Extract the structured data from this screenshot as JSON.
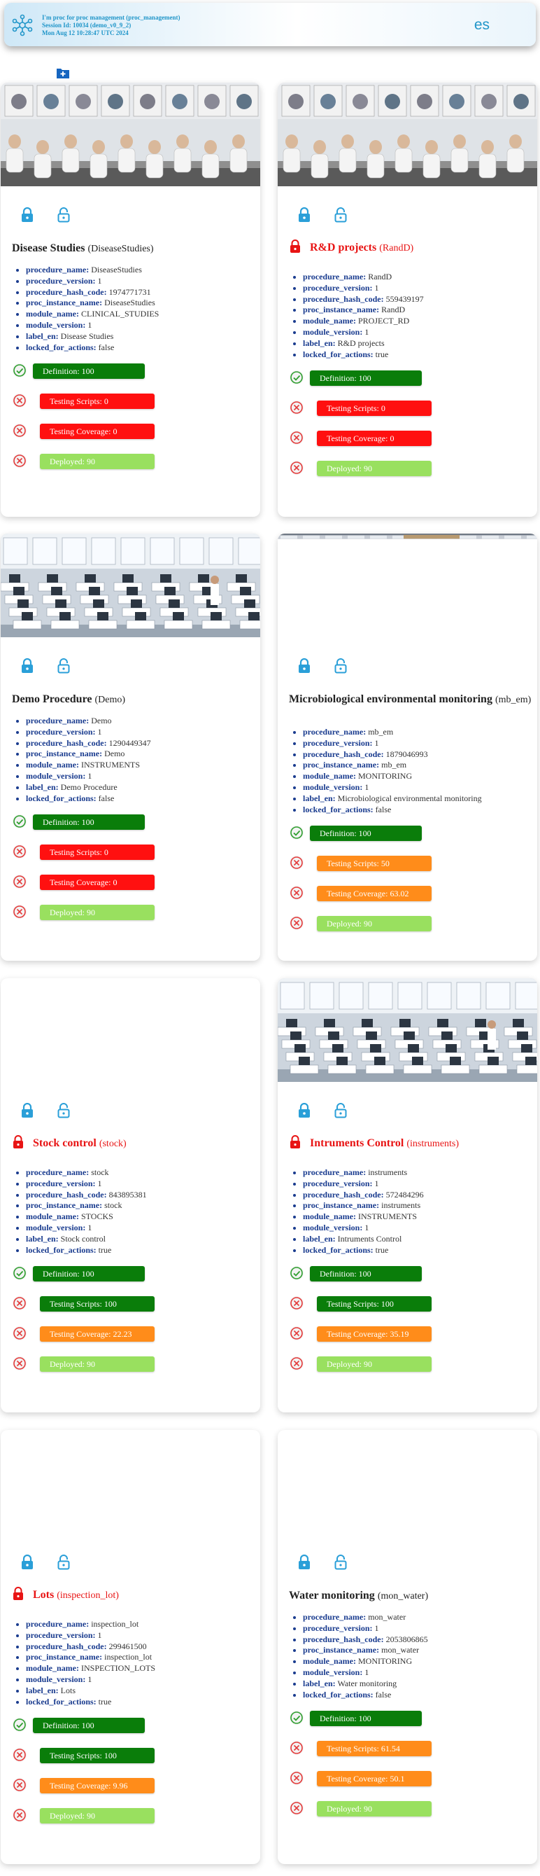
{
  "header": {
    "line1": "I'm proc for proc management (proc_management)",
    "line2": "Session Id: 10034 (demo_v0_9_2)",
    "line3": "Mon Aug 12 10:28:47 UTC 2024",
    "lang": "es"
  },
  "colors": {
    "green": "#0a7d0a",
    "red": "#ff1010",
    "orange": "#ff8c1a",
    "lightgreen": "#99e05f",
    "accent": "#2196c9"
  },
  "cards": [
    {
      "title": "Disease Studies",
      "id": "(DiseaseStudies)",
      "locked": false,
      "props": {
        "procedure_name": "DiseaseStudies",
        "procedure_version": "1",
        "procedure_hash_code": "1974771731",
        "proc_instance_name": "DiseaseStudies",
        "module_name": "CLINICAL_STUDIES",
        "module_version": "1",
        "label_en": "Disease Studies",
        "locked_for_actions": "false"
      },
      "status": {
        "definition": "Definition: 100",
        "scripts": "Testing Scripts: 0",
        "coverage": "Testing Coverage: 0",
        "deployed": "Deployed: 90"
      }
    },
    {
      "title": "R&D projects",
      "id": "(RandD)",
      "locked": true,
      "props": {
        "procedure_name": "RandD",
        "procedure_version": "1",
        "procedure_hash_code": "559439197",
        "proc_instance_name": "RandD",
        "module_name": "PROJECT_RD",
        "module_version": "1",
        "label_en": "R&D projects",
        "locked_for_actions": "true"
      },
      "status": {
        "definition": "Definition: 100",
        "scripts": "Testing Scripts: 0",
        "coverage": "Testing Coverage: 0",
        "deployed": "Deployed: 90"
      }
    },
    {
      "title": "Demo Procedure",
      "id": "(Demo)",
      "locked": false,
      "props": {
        "procedure_name": "Demo",
        "procedure_version": "1",
        "procedure_hash_code": "1290449347",
        "proc_instance_name": "Demo",
        "module_name": "INSTRUMENTS",
        "module_version": "1",
        "label_en": "Demo Procedure",
        "locked_for_actions": "false"
      },
      "status": {
        "definition": "Definition: 100",
        "scripts": "Testing Scripts: 0",
        "coverage": "Testing Coverage: 0",
        "deployed": "Deployed: 90"
      }
    },
    {
      "title": "Microbiological environmental monitoring",
      "id": "(mb_em)",
      "locked": false,
      "props": {
        "procedure_name": "mb_em",
        "procedure_version": "1",
        "procedure_hash_code": "1879046993",
        "proc_instance_name": "mb_em",
        "module_name": "MONITORING",
        "module_version": "1",
        "label_en": "Microbiological environmental monitoring",
        "locked_for_actions": "false"
      },
      "status": {
        "definition": "Definition: 100",
        "scripts": "Testing Scripts: 50",
        "coverage": "Testing Coverage: 63.02",
        "deployed": "Deployed: 90"
      }
    },
    {
      "title": "Stock control",
      "id": "(stock)",
      "locked": true,
      "props": {
        "procedure_name": "stock",
        "procedure_version": "1",
        "procedure_hash_code": "843895381",
        "proc_instance_name": "stock",
        "module_name": "STOCKS",
        "module_version": "1",
        "label_en": "Stock control",
        "locked_for_actions": "true"
      },
      "status": {
        "definition": "Definition: 100",
        "scripts": "Testing Scripts: 100",
        "coverage": "Testing Coverage: 22.23",
        "deployed": "Deployed: 90"
      }
    },
    {
      "title": "Intruments Control",
      "id": "(instruments)",
      "locked": true,
      "props": {
        "procedure_name": "instruments",
        "procedure_version": "1",
        "procedure_hash_code": "572484296",
        "proc_instance_name": "instruments",
        "module_name": "INSTRUMENTS",
        "module_version": "1",
        "label_en": "Intruments Control",
        "locked_for_actions": "true"
      },
      "status": {
        "definition": "Definition: 100",
        "scripts": "Testing Scripts: 100",
        "coverage": "Testing Coverage: 35.19",
        "deployed": "Deployed: 90"
      }
    },
    {
      "title": "Lots",
      "id": "(inspection_lot)",
      "locked": true,
      "props": {
        "procedure_name": "inspection_lot",
        "procedure_version": "1",
        "procedure_hash_code": "299461500",
        "proc_instance_name": "inspection_lot",
        "module_name": "INSPECTION_LOTS",
        "module_version": "1",
        "label_en": "Lots",
        "locked_for_actions": "true"
      },
      "status": {
        "definition": "Definition: 100",
        "scripts": "Testing Scripts: 100",
        "coverage": "Testing Coverage: 9.96",
        "deployed": "Deployed: 90"
      }
    },
    {
      "title": "Water monitoring",
      "id": "(mon_water)",
      "locked": false,
      "props": {
        "procedure_name": "mon_water",
        "procedure_version": "1",
        "procedure_hash_code": "2053806865",
        "proc_instance_name": "mon_water",
        "module_name": "MONITORING",
        "module_version": "1",
        "label_en": "Water monitoring",
        "locked_for_actions": "false"
      },
      "status": {
        "definition": "Definition: 100",
        "scripts": "Testing Scripts: 61.54",
        "coverage": "Testing Coverage: 50.1",
        "deployed": "Deployed: 90"
      }
    }
  ]
}
